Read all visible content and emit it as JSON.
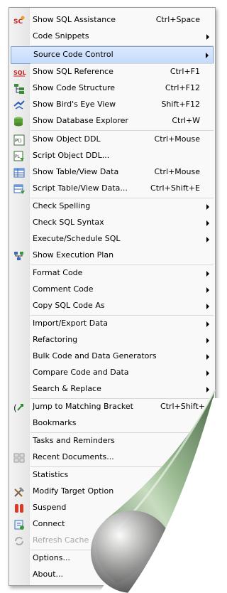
{
  "menu": {
    "items": [
      {
        "label": "Show SQL Assistance",
        "shortcut": "Ctrl+Space",
        "icon": "sql-assistance-icon"
      },
      {
        "label": "Code Snippets",
        "submenu": true
      },
      {
        "label": "Source Code Control",
        "submenu": true,
        "highlighted": true
      },
      {
        "label": "Show SQL Reference",
        "shortcut": "Ctrl+F1",
        "icon": "sql-reference-icon"
      },
      {
        "label": "Show Code Structure",
        "shortcut": "Ctrl+F12",
        "icon": "code-structure-icon"
      },
      {
        "label": "Show Bird's Eye View",
        "shortcut": "Shift+F12",
        "icon": "birds-eye-icon"
      },
      {
        "label": "Show Database Explorer",
        "shortcut": "Ctrl+W",
        "icon": "database-explorer-icon"
      },
      {
        "label": "Show Object DDL",
        "shortcut": "Ctrl+Mouse",
        "icon": "object-ddl-icon"
      },
      {
        "label": "Script Object DDL...",
        "icon": "script-ddl-icon"
      },
      {
        "label": "Show Table/View Data",
        "shortcut": "Ctrl+Mouse",
        "icon": "table-data-icon"
      },
      {
        "label": "Script Table/View Data...",
        "shortcut": "Ctrl+Shift+E",
        "icon": "script-table-icon"
      },
      {
        "label": "Check Spelling",
        "submenu": true
      },
      {
        "label": "Check SQL Syntax",
        "submenu": true
      },
      {
        "label": "Execute/Schedule SQL",
        "submenu": true
      },
      {
        "label": "Show Execution Plan",
        "icon": "execution-plan-icon"
      },
      {
        "label": "Format Code",
        "submenu": true
      },
      {
        "label": "Comment Code",
        "submenu": true
      },
      {
        "label": "Copy SQL Code As",
        "submenu": true
      },
      {
        "label": "Import/Export Data",
        "submenu": true
      },
      {
        "label": "Refactoring",
        "submenu": true
      },
      {
        "label": "Bulk Code and Data Generators",
        "submenu": true
      },
      {
        "label": "Compare Code and Data",
        "submenu": true
      },
      {
        "label": "Search & Replace",
        "submenu": true
      },
      {
        "label": "Jump to Matching Bracket",
        "shortcut": "Ctrl+Shift+",
        "icon": "matching-bracket-icon"
      },
      {
        "label": "Bookmarks"
      },
      {
        "label": "Tasks and Reminders"
      },
      {
        "label": "Recent Documents...",
        "icon": "recent-documents-icon"
      },
      {
        "label": "Statistics"
      },
      {
        "label": "Modify Target Option",
        "icon": "modify-target-icon"
      },
      {
        "label": "Suspend",
        "icon": "suspend-icon"
      },
      {
        "label": "Connect",
        "icon": "connect-icon"
      },
      {
        "label": "Refresh Cache",
        "disabled": true,
        "icon": "refresh-cache-icon"
      },
      {
        "label": "Options..."
      },
      {
        "label": "About..."
      }
    ]
  },
  "colors": {
    "highlight": "#c5dbfb",
    "curl": "#8fb08a"
  }
}
